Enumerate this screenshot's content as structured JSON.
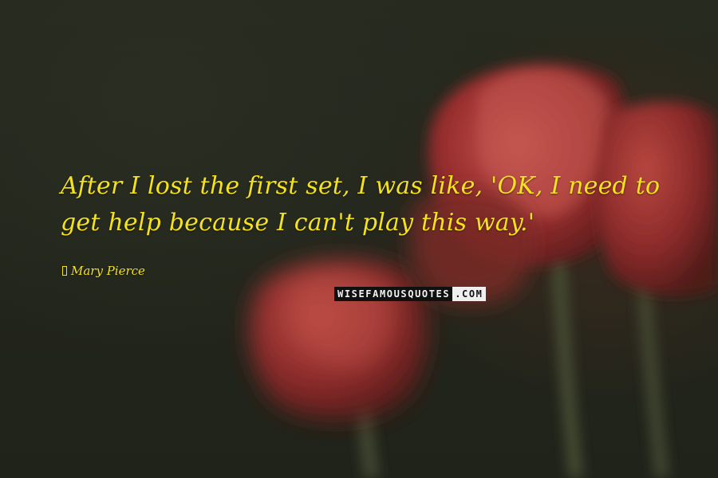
{
  "quote": {
    "text": "After I lost the first set, I was like, 'OK, I need to get help because I can't play this way.'",
    "author": "Mary Pierce"
  },
  "watermark": {
    "part1": "WISEFAMOUSQUOTES",
    "part2": ".COM"
  },
  "colors": {
    "text": "#f4e21f",
    "background": "#23261c",
    "flower": "#b23a38"
  }
}
